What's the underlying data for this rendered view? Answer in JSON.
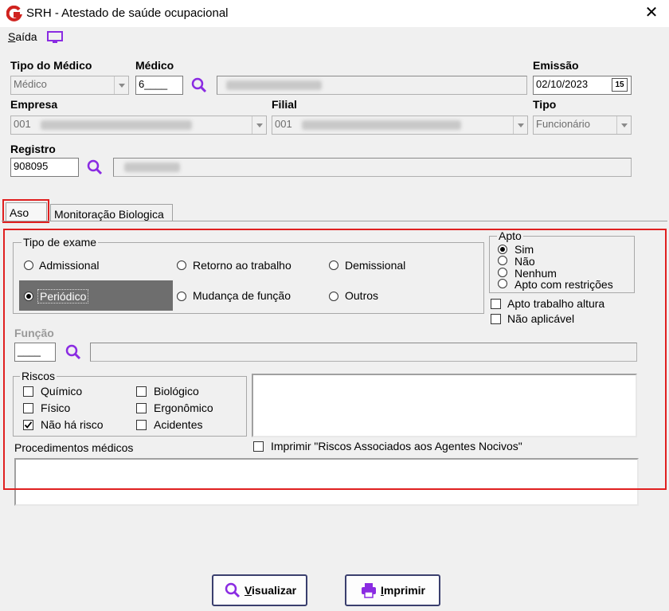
{
  "window": {
    "title": "SRH - Atestado de saúde ocupacional",
    "close_glyph": "✕"
  },
  "menu": {
    "saida_first": "S",
    "saida_rest": "aída"
  },
  "labels": {
    "tipo_medico": "Tipo do Médico",
    "medico": "Médico",
    "emissao": "Emissão",
    "empresa": "Empresa",
    "filial": "Filial",
    "tipo": "Tipo",
    "registro": "Registro"
  },
  "fields": {
    "tipo_medico_value": "Médico",
    "medico_code": "6____",
    "emissao_value": "02/10/2023",
    "calendar_glyph": "15",
    "empresa_code": "001",
    "filial_code": "001",
    "tipo_value": "Funcionário",
    "registro_value": "908095",
    "funcao_code": "____"
  },
  "tabs": [
    "Aso",
    "Monitoração Biologica"
  ],
  "aso": {
    "tipo_exame_title": "Tipo de exame",
    "tipo_exame_options": [
      "Admissional",
      "Retorno ao trabalho",
      "Demissional",
      "Periódico",
      "Mudança de função",
      "Outros"
    ],
    "tipo_exame_selected": "Periódico",
    "apto_title": "Apto",
    "apto_options": [
      "Sim",
      "Não",
      "Nenhum",
      "Apto com restrições"
    ],
    "apto_selected": "Sim",
    "apto_trabalho_altura": "Apto trabalho altura",
    "nao_aplicavel": "Não aplicável",
    "funcao_label": "Função",
    "riscos_title": "Riscos",
    "riscos": [
      {
        "label": "Químico",
        "checked": false
      },
      {
        "label": "Biológico",
        "checked": false
      },
      {
        "label": "Físico",
        "checked": false
      },
      {
        "label": "Ergonômico",
        "checked": false
      },
      {
        "label": "Não há risco",
        "checked": true
      },
      {
        "label": "Acidentes",
        "checked": false
      }
    ],
    "procedimentos_label": "Procedimentos médicos",
    "imprimir_label": "Imprimir  \"Riscos Associados aos Agentes Nocivos\""
  },
  "buttons": {
    "visualizar_first": "V",
    "visualizar_rest": "isualizar",
    "imprimir_first": "I",
    "imprimir_rest": "mprimir"
  },
  "colors": {
    "accent_purple": "#8a2be2",
    "highlight_red": "#e02020",
    "selected_bg": "#6e6e6e"
  }
}
